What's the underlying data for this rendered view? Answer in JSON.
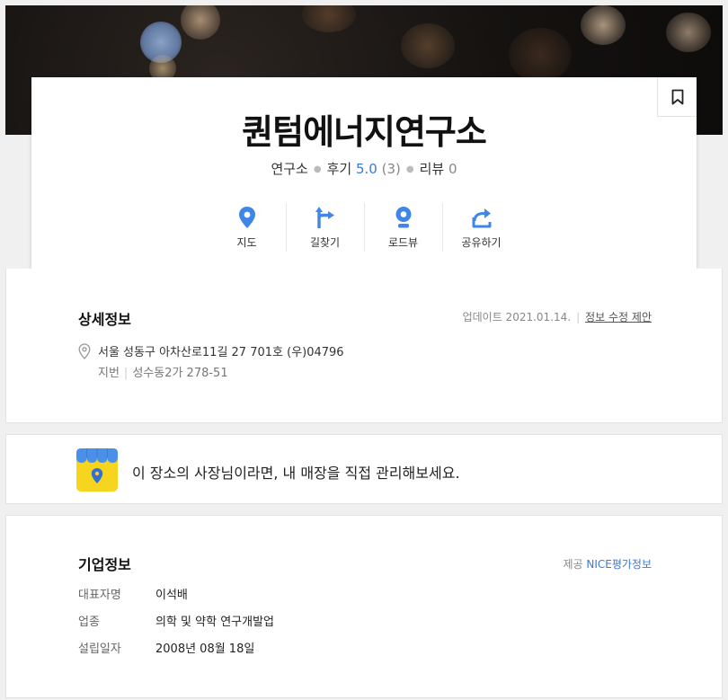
{
  "place": {
    "name": "퀀텀에너지연구소",
    "category": "연구소",
    "review_label": "후기",
    "review_score": "5.0",
    "review_count": "(3)",
    "blog_label": "리뷰",
    "blog_count": "0"
  },
  "actions": [
    {
      "label": "지도",
      "icon": "map-pin-icon"
    },
    {
      "label": "길찾기",
      "icon": "directions-icon"
    },
    {
      "label": "로드뷰",
      "icon": "roadview-icon"
    },
    {
      "label": "공유하기",
      "icon": "share-icon"
    }
  ],
  "detail": {
    "title": "상세정보",
    "updated": "업데이트 2021.01.14.",
    "suggest_edit": "정보 수정 제안",
    "address": "서울 성동구 아차산로11길 27 701호 (우)04796",
    "jibun_label": "지번",
    "jibun": "성수동2가 278-51"
  },
  "owner": {
    "text": "이 장소의 사장님이라면, 내 매장을 직접 관리해보세요."
  },
  "company": {
    "title": "기업정보",
    "provider_prefix": "제공",
    "provider": "NICE평가정보",
    "rows": [
      {
        "key": "대표자명",
        "value": "이석배"
      },
      {
        "key": "업종",
        "value": "의학 및 약학 연구개발업"
      },
      {
        "key": "설립일자",
        "value": "2008년 08월 18일"
      }
    ]
  },
  "colors": {
    "accent_blue": "#3a78d8",
    "icon_blue": "#3e86e8",
    "owner_yellow": "#f7d51e"
  }
}
